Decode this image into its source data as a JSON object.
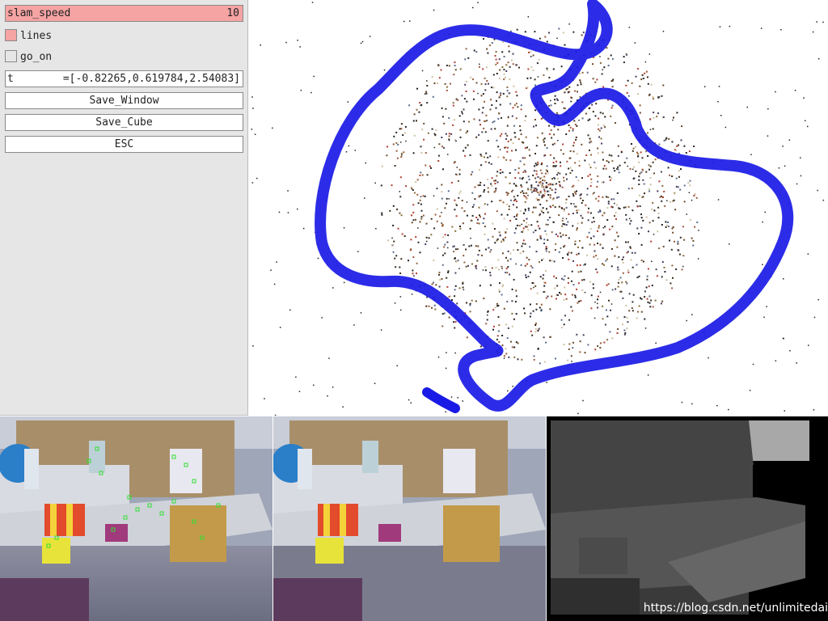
{
  "panel": {
    "slam_speed": {
      "label": "slam_speed",
      "value": "10"
    },
    "lines": {
      "label": "lines",
      "checked": true
    },
    "go_on": {
      "label": "go_on",
      "checked": false
    },
    "t": {
      "label": "t",
      "value": "=[-0.82265,0.619784,2.54083]"
    },
    "buttons": {
      "save_window": "Save_Window",
      "save_cube": "Save_Cube",
      "esc": "ESC"
    }
  },
  "colors": {
    "accent": "#f5a3a3",
    "trajectory": "#1a1ae6",
    "panel_bg": "#e6e6e6"
  },
  "watermark": "https://blog.csdn.net/unlimitedai"
}
